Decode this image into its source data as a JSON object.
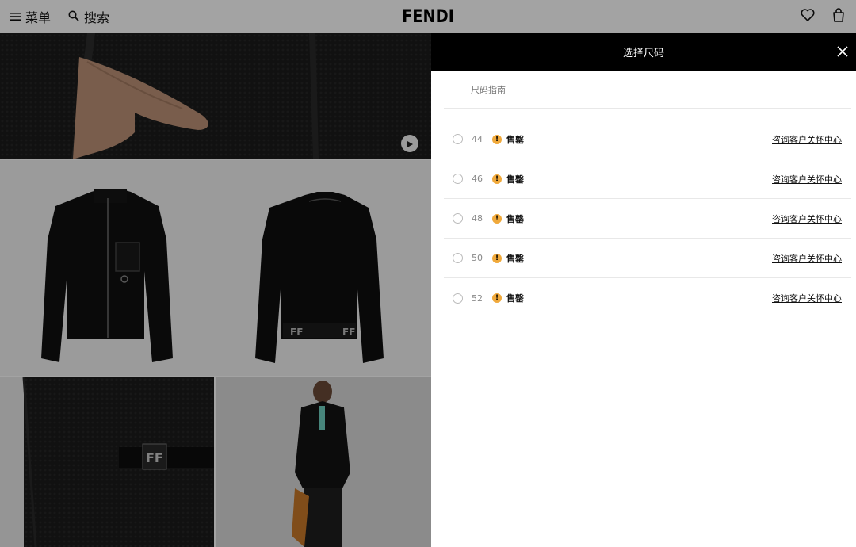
{
  "header": {
    "menu_label": "菜单",
    "search_label": "搜索",
    "logo": "FENDI"
  },
  "gallery": {
    "flat_logo_text": "FF"
  },
  "size_panel": {
    "title": "选择尺码",
    "size_guide": "尺码指南",
    "sizes": [
      {
        "size": "44",
        "status": "售罄",
        "contact": "咨询客户关怀中心"
      },
      {
        "size": "46",
        "status": "售罄",
        "contact": "咨询客户关怀中心"
      },
      {
        "size": "48",
        "status": "售罄",
        "contact": "咨询客户关怀中心"
      },
      {
        "size": "50",
        "status": "售罄",
        "contact": "咨询客户关怀中心"
      },
      {
        "size": "52",
        "status": "售罄",
        "contact": "咨询客户关怀中心"
      }
    ]
  },
  "colors": {
    "panel_header_bg": "#000000",
    "warning": "#f0a93b",
    "overlay": "rgba(0,0,0,0.36)"
  }
}
